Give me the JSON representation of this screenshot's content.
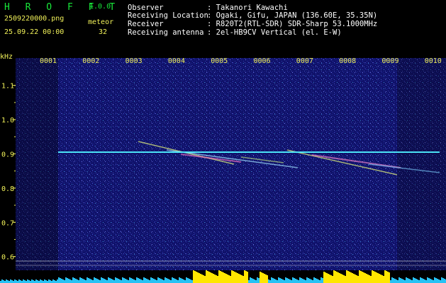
{
  "app": {
    "name": "H R O F F T",
    "version": "1.0.0",
    "filename": "2509220000.png",
    "datetime": "25.09.22 00:00",
    "meteor_label": "meteor",
    "meteor_count": "32"
  },
  "info": {
    "rows": [
      {
        "label": "Observer",
        "value": ": Takanori Kawachi"
      },
      {
        "label": "Receiving Location",
        "value": ": Ogaki, Gifu, JAPAN (136.60E, 35.35N)"
      },
      {
        "label": "Receiver",
        "value": ": R820T2(RTL-SDR) SDR-Sharp 53.1000MHz"
      },
      {
        "label": "Receiving antenna",
        "value": ": 2el-HB9CV Vertical (el. E-W)"
      }
    ]
  },
  "spectrogram": {
    "unit_label": "kHz",
    "time_labels": [
      "0001",
      "0002",
      "0003",
      "0004",
      "0005",
      "0006",
      "0007",
      "0008",
      "0009",
      "0010"
    ],
    "freq_ticks": [
      {
        "label": "1.1",
        "value": 1.1
      },
      {
        "label": "1.0",
        "value": 1.0
      },
      {
        "label": "0.9",
        "value": 0.9
      },
      {
        "label": "0.8",
        "value": 0.8
      },
      {
        "label": "0.7",
        "value": 0.7
      },
      {
        "label": "0.6",
        "value": 0.6
      }
    ],
    "freq_range": [
      0.56,
      1.18
    ],
    "carrier_freq": 0.905,
    "colors": {
      "background": "#10126a",
      "tick_text": "#f2f25a",
      "carrier": "#4ff0ff",
      "level_bar": "#26c2f4",
      "level_peak": "#ffe600"
    }
  }
}
